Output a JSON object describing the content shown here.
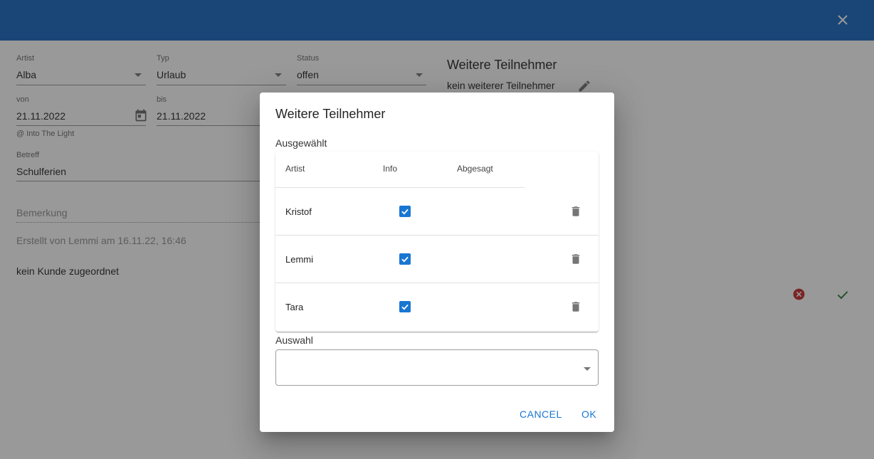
{
  "colors": {
    "toolbar": "#1565c0",
    "accent": "#1976d2",
    "error": "#c62828",
    "success": "#2e7d32"
  },
  "toolbar": {
    "close_icon": "close-icon"
  },
  "form": {
    "artist": {
      "label": "Artist",
      "value": "Alba"
    },
    "typ": {
      "label": "Typ",
      "value": "Urlaub"
    },
    "status": {
      "label": "Status",
      "value": "offen"
    },
    "von": {
      "label": "von",
      "value": "21.11.2022",
      "hint": "@ Into The Light"
    },
    "bis": {
      "label": "bis",
      "value": "21.11.2022"
    },
    "betreff": {
      "label": "Betreff",
      "value": "Schulferien"
    },
    "bemerkung": {
      "placeholder": "Bemerkung"
    },
    "created": "Erstellt von Lemmi am 16.11.22, 16:46",
    "kunde": "kein Kunde zugeordnet"
  },
  "weitere": {
    "title": "Weitere Teilnehmer",
    "value": "kein weiterer Teilnehmer"
  },
  "dialog": {
    "title": "Weitere Teilnehmer",
    "selected_label": "Ausgewählt",
    "columns": [
      "Artist",
      "Info",
      "Abgesagt"
    ],
    "rows": [
      {
        "artist": "Kristof",
        "info": true
      },
      {
        "artist": "Lemmi",
        "info": true
      },
      {
        "artist": "Tara",
        "info": true
      }
    ],
    "auswahl_label": "Auswahl",
    "auswahl_value": "",
    "cancel": "CANCEL",
    "ok": "OK"
  }
}
